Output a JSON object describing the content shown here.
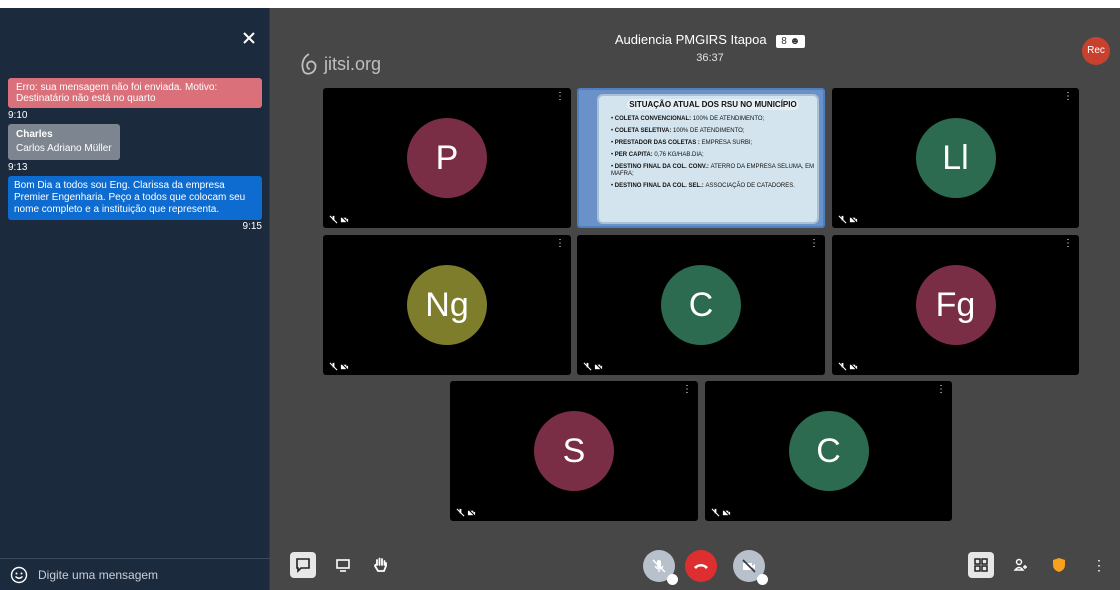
{
  "chat": {
    "error_message": "Erro: sua mensagem não foi enviada. Motivo: Destinatário não está no quarto",
    "error_time": "9:10",
    "msg1_sender": "Charles",
    "msg1_text": "Carlos Adriano Müller",
    "msg1_time": "9:13",
    "msg2_text": "Bom Dia a todos sou Eng. Clarissa da empresa Premier Engenharia. Peço a todos que colocam seu nome completo e a instituição que representa.",
    "msg2_time": "9:15",
    "input_placeholder": "Digite uma mensagem"
  },
  "header": {
    "logo": "jitsi.org",
    "meeting_title": "Audiencia PMGIRS Itapoa",
    "participant_count": "8",
    "timer": "36:37",
    "rec_label": "Rec"
  },
  "slide": {
    "title": "SITUAÇÃO ATUAL DOS RSU NO MUNICÍPIO",
    "items": [
      {
        "label": "COLETA CONVENCIONAL:",
        "value": "100% DE ATENDIMENTO;"
      },
      {
        "label": "COLETA SELETIVA:",
        "value": "100% DE ATENDIMENTO;"
      },
      {
        "label": "PRESTADOR DAS COLETAS :",
        "value": "EMPRESA SURBI;"
      },
      {
        "label": "PER CAPITA:",
        "value": "0,76 KG/HAB.DIA;"
      },
      {
        "label": "DESTINO FINAL DA COL. CONV.:",
        "value": "ATERRO DA EMPRESA SELUMA, EM MAFRA;"
      },
      {
        "label": "DESTINO FINAL DA COL. SEL.:",
        "value": "ASSOCIAÇÃO DE CATADORES."
      }
    ]
  },
  "participants": [
    {
      "initials": "P",
      "color": "#7a2e45"
    },
    {
      "initials": "Ll",
      "color": "#2c6b4f"
    },
    {
      "initials": "Ng",
      "color": "#7e7d2c"
    },
    {
      "initials": "C",
      "color": "#2c6b4f"
    },
    {
      "initials": "Fg",
      "color": "#7a2e45"
    },
    {
      "initials": "S",
      "color": "#7a2e45"
    },
    {
      "initials": "C",
      "color": "#2c6b4f"
    }
  ],
  "icons": {
    "close": "close-icon",
    "emoji": "emoji-icon",
    "chat": "chat-icon",
    "screen": "screen-share-icon",
    "hand": "raise-hand-icon",
    "mic": "mic-muted-icon",
    "hangup": "hangup-icon",
    "camera": "camera-muted-icon",
    "tile": "tile-view-icon",
    "invite": "invite-icon",
    "security": "shield-icon",
    "more": "more-icon"
  }
}
